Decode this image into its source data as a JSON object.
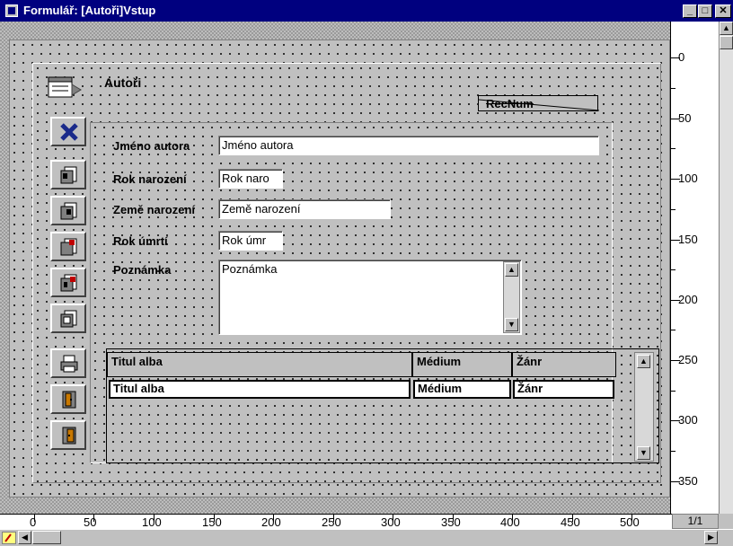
{
  "window": {
    "title": "Formulář: [Autoři]Vstup"
  },
  "form": {
    "section_title": "Autoři",
    "recnum_label": "RecNum",
    "fields": [
      {
        "label": "Jméno autora",
        "value": "Jméno autora"
      },
      {
        "label": "Rok narození",
        "value": "Rok naro"
      },
      {
        "label": "Země narození",
        "value": "Země narození"
      },
      {
        "label": "Rok úmrtí",
        "value": "Rok úmr"
      },
      {
        "label": "Poznámka",
        "value": "Poznámka"
      }
    ],
    "grid": {
      "headers": [
        "Titul alba",
        "Médium",
        "Žánr"
      ],
      "row": [
        "Titul alba",
        "Médium",
        "Žánr"
      ]
    }
  },
  "toolbar": {
    "icons": [
      "close-x-icon",
      "first-record-icon",
      "previous-record-icon",
      "next-record-icon",
      "last-record-icon",
      "new-record-icon",
      "print-icon",
      "exit-icon",
      "door-icon"
    ]
  },
  "ruler": {
    "vertical": [
      "0",
      "50",
      "100",
      "150",
      "200",
      "250",
      "300",
      "350"
    ],
    "horizontal": [
      "0",
      "50",
      "100",
      "150",
      "200",
      "250",
      "300",
      "350",
      "400",
      "450",
      "500"
    ]
  },
  "status": {
    "page": "1/1"
  },
  "colors": {
    "titlebar": "#00007f",
    "workspace": "#c0c0c0"
  }
}
